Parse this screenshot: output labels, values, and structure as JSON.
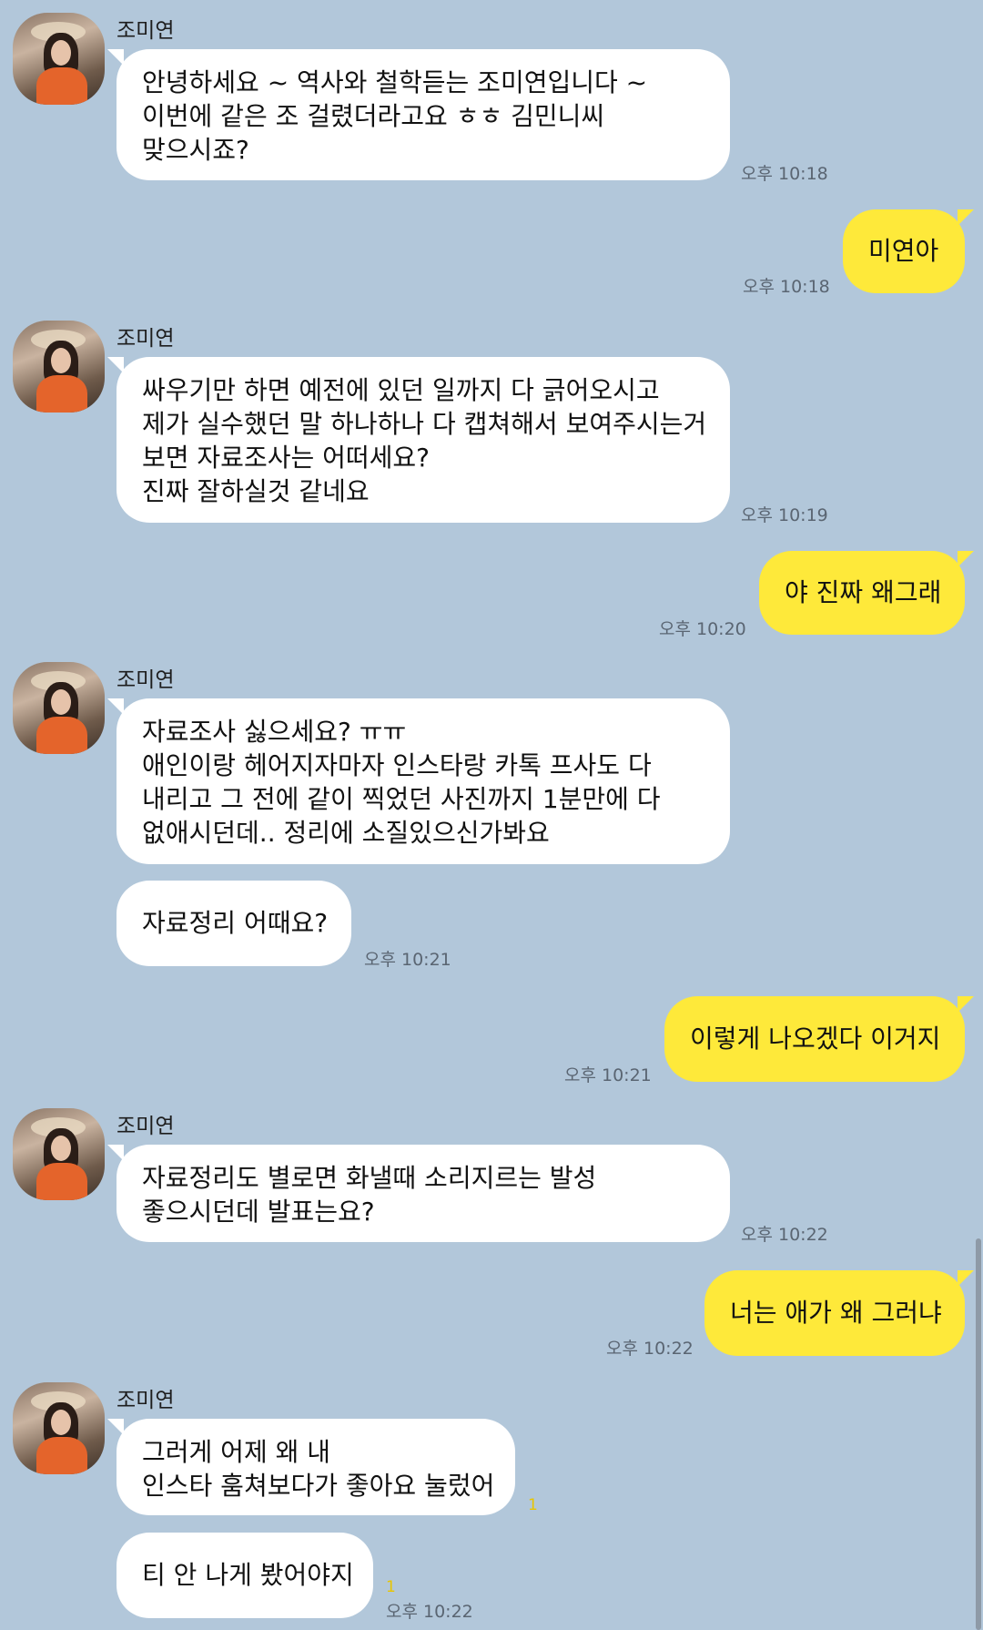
{
  "contact": {
    "name": "조미연"
  },
  "messages": [
    {
      "from": "them",
      "lines": [
        "안녕하세요 ~ 역사와 철학듣는 조미연입니다 ~",
        "이번에 같은 조 걸렸더라고요 ㅎㅎ 김민니씨",
        "맞으시죠?"
      ],
      "time": "오후 10:18"
    },
    {
      "from": "me",
      "lines": [
        "미연아"
      ],
      "time": "오후 10:18"
    },
    {
      "from": "them",
      "lines": [
        "싸우기만 하면 예전에 있던 일까지 다 긁어오시고",
        "제가 실수했던 말 하나하나 다 캡쳐해서 보여주시는거",
        "보면 자료조사는 어떠세요?",
        "진짜 잘하실것 같네요"
      ],
      "time": "오후 10:19"
    },
    {
      "from": "me",
      "lines": [
        "야 진짜 왜그래"
      ],
      "time": "오후 10:20"
    },
    {
      "from": "them",
      "lines": [
        "자료조사 싫으세요? ㅠㅠ",
        "애인이랑 헤어지자마자 인스타랑 카톡 프사도 다",
        "내리고 그 전에 같이 찍었던 사진까지 1분만에 다",
        "없애시던데.. 정리에 소질있으신가봐요"
      ],
      "time": ""
    },
    {
      "from": "them",
      "lines": [
        "자료정리 어때요?"
      ],
      "time": "오후 10:21"
    },
    {
      "from": "me",
      "lines": [
        "이렇게 나오겠다 이거지"
      ],
      "time": "오후 10:21"
    },
    {
      "from": "them",
      "lines": [
        "자료정리도 별로면 화낼때 소리지르는 발성",
        "좋으시던데 발표는요?"
      ],
      "time": "오후 10:22"
    },
    {
      "from": "me",
      "lines": [
        "너는 애가 왜 그러냐"
      ],
      "time": "오후 10:22"
    },
    {
      "from": "them",
      "lines": [
        "그러게 어제 왜 내",
        "인스타 훔쳐보다가 좋아요 눌렀어"
      ],
      "time": "",
      "unread": "1"
    },
    {
      "from": "them",
      "lines": [
        "티 안 나게 봤어야지"
      ],
      "time": "오후 10:22",
      "unread": "1"
    }
  ]
}
